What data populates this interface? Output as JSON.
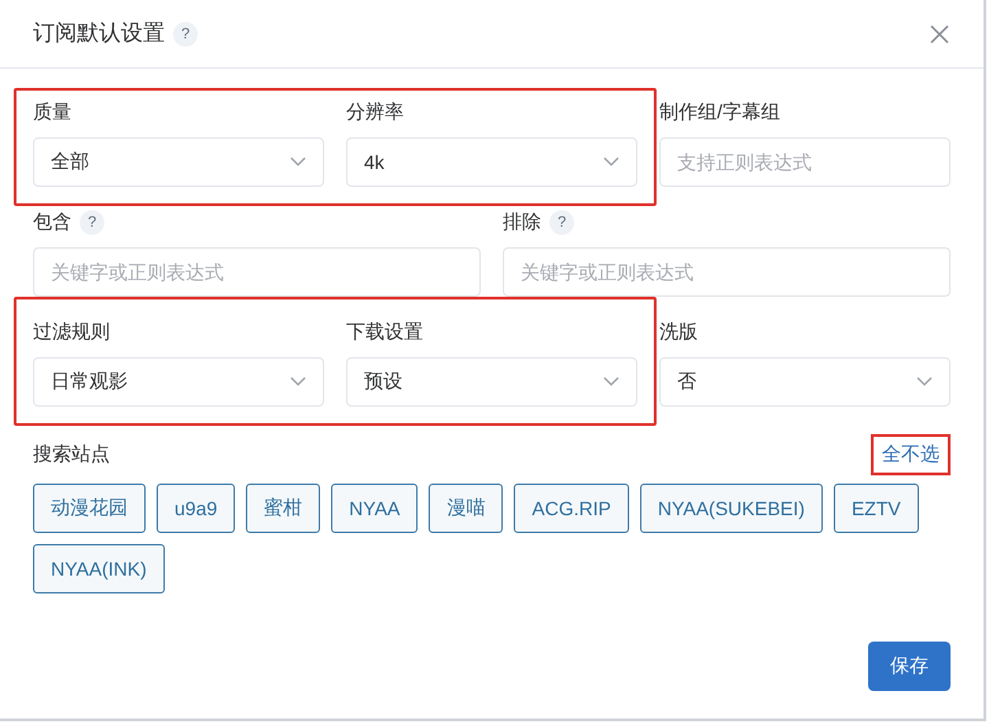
{
  "dialog": {
    "title": "订阅默认设置",
    "title_help": "?"
  },
  "rows": [
    {
      "groups": [
        {
          "highlighted": true,
          "fields": [
            {
              "label": "质量",
              "kind": "select",
              "value": "全部"
            },
            {
              "label": "分辨率",
              "kind": "select",
              "value": "4k"
            }
          ]
        },
        {
          "fields": [
            {
              "label": "制作组/字幕组",
              "kind": "input",
              "placeholder": "支持正则表达式"
            }
          ]
        }
      ]
    },
    {
      "groups": [
        {
          "fields": [
            {
              "label": "包含",
              "help": "?",
              "kind": "input",
              "placeholder": "关键字或正则表达式"
            }
          ]
        },
        {
          "fields": [
            {
              "label": "排除",
              "help": "?",
              "kind": "input",
              "placeholder": "关键字或正则表达式"
            }
          ]
        }
      ]
    },
    {
      "groups": [
        {
          "highlighted": true,
          "fields": [
            {
              "label": "过滤规则",
              "kind": "select",
              "value": "日常观影"
            },
            {
              "label": "下载设置",
              "kind": "select",
              "value": "预设"
            }
          ]
        },
        {
          "fields": [
            {
              "label": "洗版",
              "kind": "select",
              "value": "否"
            }
          ]
        }
      ]
    }
  ],
  "sites": {
    "label": "搜索站点",
    "toggle": {
      "text": "全不选",
      "highlighted": true
    },
    "chips": [
      {
        "text": "动漫花园",
        "selected": true
      },
      {
        "text": "u9a9",
        "selected": true
      },
      {
        "text": "蜜柑",
        "selected": true
      },
      {
        "text": "NYAA",
        "selected": true
      },
      {
        "text": "漫喵",
        "selected": true
      },
      {
        "text": "ACG.RIP",
        "selected": true
      },
      {
        "text": "NYAA(SUKEBEI)",
        "selected": true
      },
      {
        "text": "EZTV",
        "selected": true
      },
      {
        "text": "NYAA(INK)",
        "selected": true
      }
    ]
  },
  "save_button": "保存"
}
